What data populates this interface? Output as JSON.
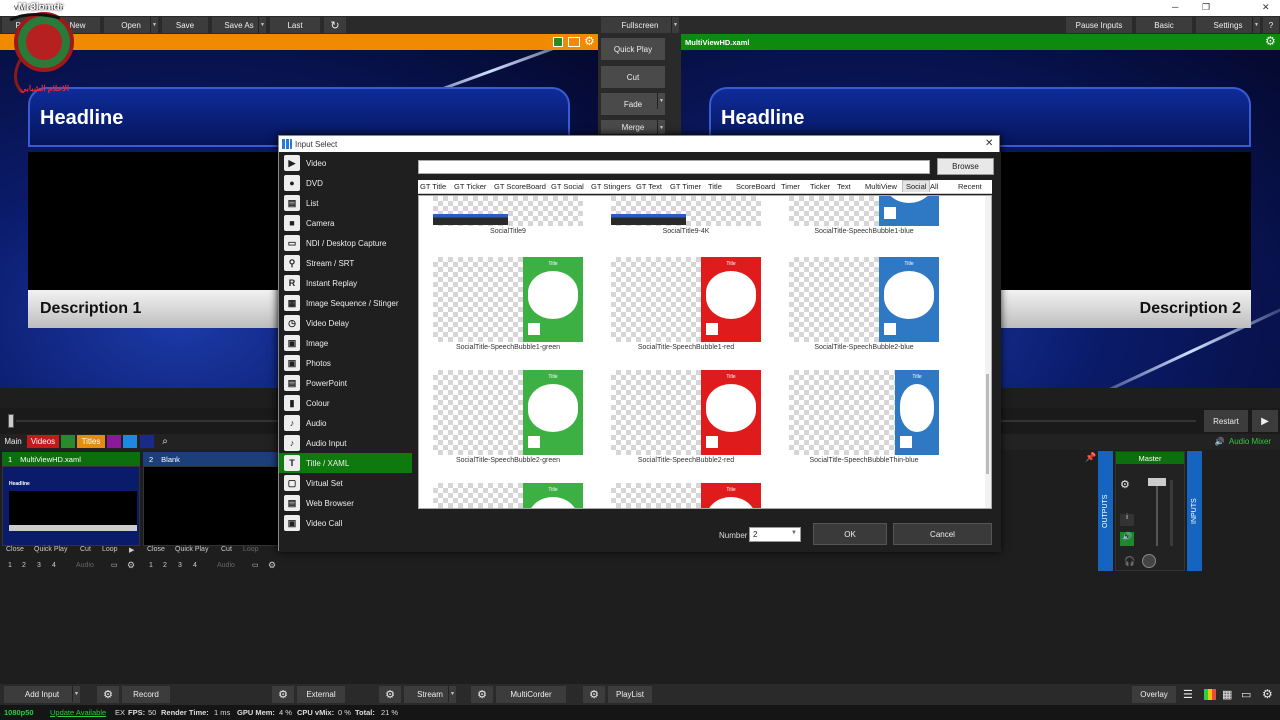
{
  "window": {
    "title": "vMix 0.34 x64",
    "min": "─",
    "max": "❐",
    "close": "✕"
  },
  "logo": {
    "top": "Mr3lomdr",
    "bottom": "الاعلام الشبابي"
  },
  "menu": {
    "preset": "Preset",
    "new": "New",
    "open": "Open",
    "save": "Save",
    "save_as": "Save As",
    "last": "Last",
    "fullscreen": "Fullscreen",
    "pause_inputs": "Pause Inputs",
    "basic": "Basic",
    "settings": "Settings",
    "help": "?"
  },
  "preview": {
    "title_label": "Headline",
    "desc_label": "Description 1"
  },
  "program": {
    "name": "MultiViewHD.xaml",
    "title_label": "Headline",
    "desc_label": "Description 2"
  },
  "transitions": {
    "quick_play": "Quick Play",
    "cut": "Cut",
    "fade": "Fade",
    "merge": "Merge"
  },
  "playback": {
    "restart": "Restart",
    "play": "▶"
  },
  "tabs": {
    "main": "Main",
    "videos": "Videos",
    "titles": "Titles",
    "audio_mixer": "Audio Mixer"
  },
  "inputs": [
    {
      "num": "1",
      "name": "MultiViewHD.xaml",
      "thumb_headline": "Headline"
    },
    {
      "num": "2",
      "name": "Blank"
    }
  ],
  "input_controls": {
    "close": "Close",
    "quick_play": "Quick Play",
    "cut": "Cut",
    "loop": "Loop",
    "n1": "1",
    "n2": "2",
    "n3": "3",
    "n4": "4",
    "audio": "Audio"
  },
  "audio": {
    "master": "Master",
    "outputs": "OUTPUTS",
    "inputs": "INPUTS"
  },
  "bottom": {
    "add_input": "Add Input",
    "record": "Record",
    "external": "External",
    "stream": "Stream",
    "multicorder": "MultiCorder",
    "playlist": "PlayList",
    "overlay": "Overlay"
  },
  "status": {
    "resolution": "1080p50",
    "update": "Update Available",
    "ex": "EX",
    "fps_label": "FPS:",
    "fps": "50",
    "render_label": "Render Time:",
    "render": "1 ms",
    "gpu_label": "GPU Mem:",
    "gpu": "4 %",
    "cpu_label": "CPU vMix:",
    "cpu": "0 %",
    "total_label": "Total:",
    "total": "21 %"
  },
  "dialog": {
    "title": "Input Select",
    "browse": "Browse",
    "number_label": "Number",
    "number_value": "2",
    "ok": "OK",
    "cancel": "Cancel",
    "categories": [
      "Video",
      "DVD",
      "List",
      "Camera",
      "NDI / Desktop Capture",
      "Stream / SRT",
      "Instant Replay",
      "Image Sequence / Stinger",
      "Video Delay",
      "Image",
      "Photos",
      "PowerPoint",
      "Colour",
      "Audio",
      "Audio Input",
      "Title / XAML",
      "Virtual Set",
      "Web Browser",
      "Video Call"
    ],
    "selected_category": "Title / XAML",
    "filter_tabs": [
      "GT Title",
      "GT Ticker",
      "GT ScoreBoard",
      "GT Social",
      "GT Stingers",
      "GT Text",
      "GT Timer",
      "Title",
      "ScoreBoard",
      "Timer",
      "Ticker",
      "Text",
      "MultiView",
      "Social",
      "All",
      "Recent"
    ],
    "selected_filter": "Social",
    "templates": [
      "SocialTitle9",
      "SocialTitle9-4K",
      "SocialTitle-SpeechBubble1-blue",
      "SocialTitle-SpeechBubble1-green",
      "SocialTitle-SpeechBubble1-red",
      "SocialTitle-SpeechBubble2-blue",
      "SocialTitle-SpeechBubble2-green",
      "SocialTitle-SpeechBubble2-red",
      "SocialTitle-SpeechBubbleThin-blue"
    ],
    "card_title": "Title",
    "card_colors": {
      "green": "#3cb043",
      "red": "#e01b1b",
      "blue": "#2f78c4"
    }
  }
}
